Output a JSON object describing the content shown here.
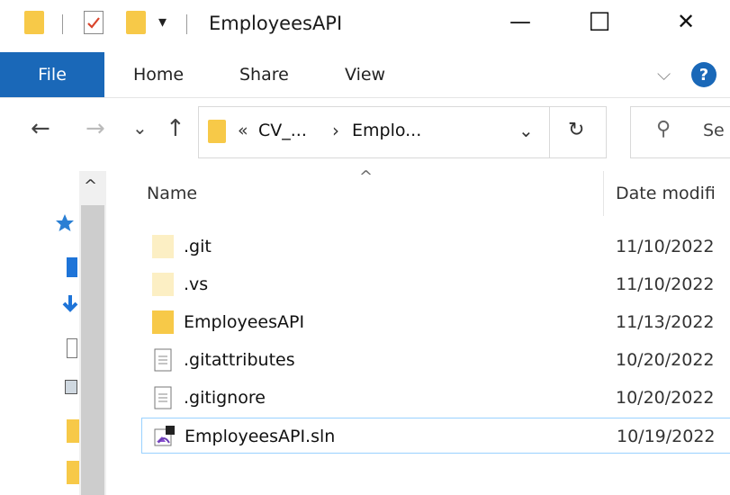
{
  "window": {
    "title": "EmployeesAPI",
    "minimize_glyph": "—",
    "maximize_glyph": "☐",
    "close_glyph": "✕",
    "quick_access_dropdown": "▾"
  },
  "ribbon": {
    "tabs": [
      "File",
      "Home",
      "Share",
      "View"
    ],
    "collapse_glyph": "⌵",
    "help_label": "?"
  },
  "address": {
    "back_glyph": "←",
    "forward_glyph": "→",
    "recent_glyph": "⌄",
    "up_glyph": "↑",
    "overflow": "«",
    "crumb1": "CV_...",
    "crumb_sep": "›",
    "crumb2": "Emplo...",
    "dropdown_glyph": "⌄",
    "refresh_glyph": "↻",
    "search_placeholder": "Se",
    "search_glyph": "⚲"
  },
  "navpane": {
    "scroll_up_glyph": "^"
  },
  "file_list": {
    "columns": {
      "name": "Name",
      "date": "Date modifi",
      "sort_glyph": "^"
    },
    "rows": [
      {
        "name": ".git",
        "date": "11/10/2022",
        "icon": "folder-hidden-icon"
      },
      {
        "name": ".vs",
        "date": "11/10/2022",
        "icon": "folder-hidden-icon"
      },
      {
        "name": "EmployeesAPI",
        "date": "11/13/2022",
        "icon": "folder-icon"
      },
      {
        "name": ".gitattributes",
        "date": "10/20/2022",
        "icon": "document-icon"
      },
      {
        "name": ".gitignore",
        "date": "10/20/2022",
        "icon": "document-icon"
      },
      {
        "name": "EmployeesAPI.sln",
        "date": "10/19/2022",
        "icon": "visual-studio-solution-icon"
      }
    ]
  },
  "colors": {
    "accent": "#1a68b8",
    "folder": "#f7c948",
    "selection_border": "#99d1ff"
  }
}
